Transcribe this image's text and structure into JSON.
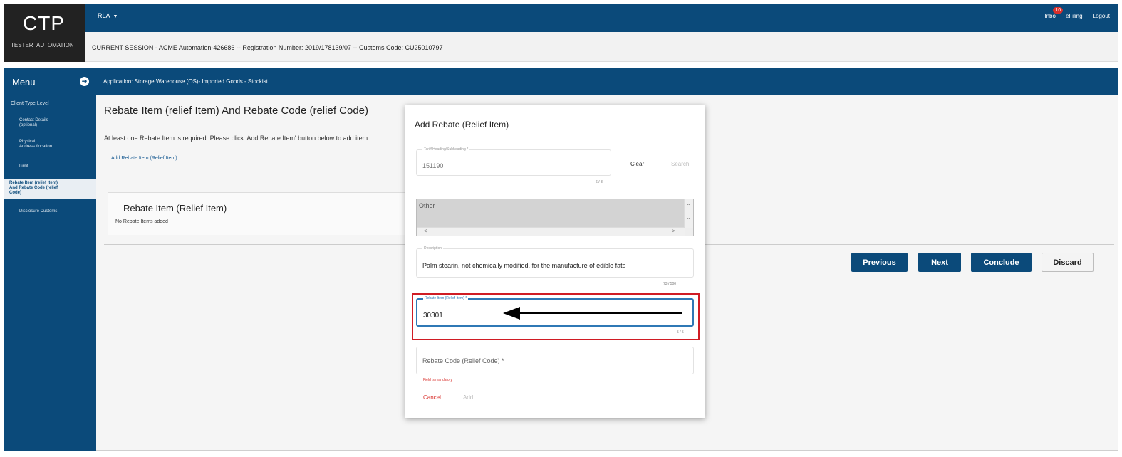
{
  "header": {
    "logo": "CTP",
    "user": "TESTER_AUTOMATION",
    "program": "RLA",
    "inbox_label": "Inbo",
    "inbox_count": "10",
    "efiling": "eFiling",
    "logout": "Logout",
    "session": "CURRENT SESSION - ACME Automation-426686 -- Registration Number: 2019/178139/07 -- Customs Code: CU25010797"
  },
  "sidebar": {
    "title": "Menu",
    "level": "Client Type Level",
    "items": [
      {
        "label": "Contact Details\n(optional)"
      },
      {
        "label": "Physical\nAddress /location"
      },
      {
        "label": "Limit"
      },
      {
        "label": "Rebate Item (relief Item)\nAnd Rebate Code (relief\nCode)"
      },
      {
        "label": "Disclosure Customs"
      }
    ]
  },
  "app_bar": {
    "text": "Application: Storage Warehouse (OS)- Imported Goods - Stockist"
  },
  "main": {
    "title": "Rebate Item (relief Item) And Rebate Code (relief Code)",
    "info": "At least one Rebate Item is required. Please click 'Add Rebate Item' button below to add item",
    "add_link": "Add Rebate Item (Relief Item)",
    "card_title": "Rebate Item (Relief Item)",
    "card_empty": "No Rebate Items added",
    "buttons": {
      "previous": "Previous",
      "next": "Next",
      "conclude": "Conclude",
      "discard": "Discard"
    }
  },
  "modal": {
    "title": "Add Rebate (Relief Item)",
    "tariff": {
      "label": "Tariff Heading/Subheading *",
      "value": "151190",
      "counter": "6 / 8"
    },
    "clear": "Clear",
    "search": "Search",
    "listbox": {
      "option": "Other"
    },
    "description": {
      "label": "Description",
      "value": "Palm stearin, not chemically modified, for the manufacture of edible fats",
      "counter": "73 / 500"
    },
    "rebate_item": {
      "label": "Rebate Item (Relief Item) *",
      "value": "30301",
      "counter": "5 / 5"
    },
    "rebate_code": {
      "placeholder": "Rebate Code (Relief Code) *",
      "error": "Field is mandatory"
    },
    "cancel": "Cancel",
    "add": "Add"
  }
}
